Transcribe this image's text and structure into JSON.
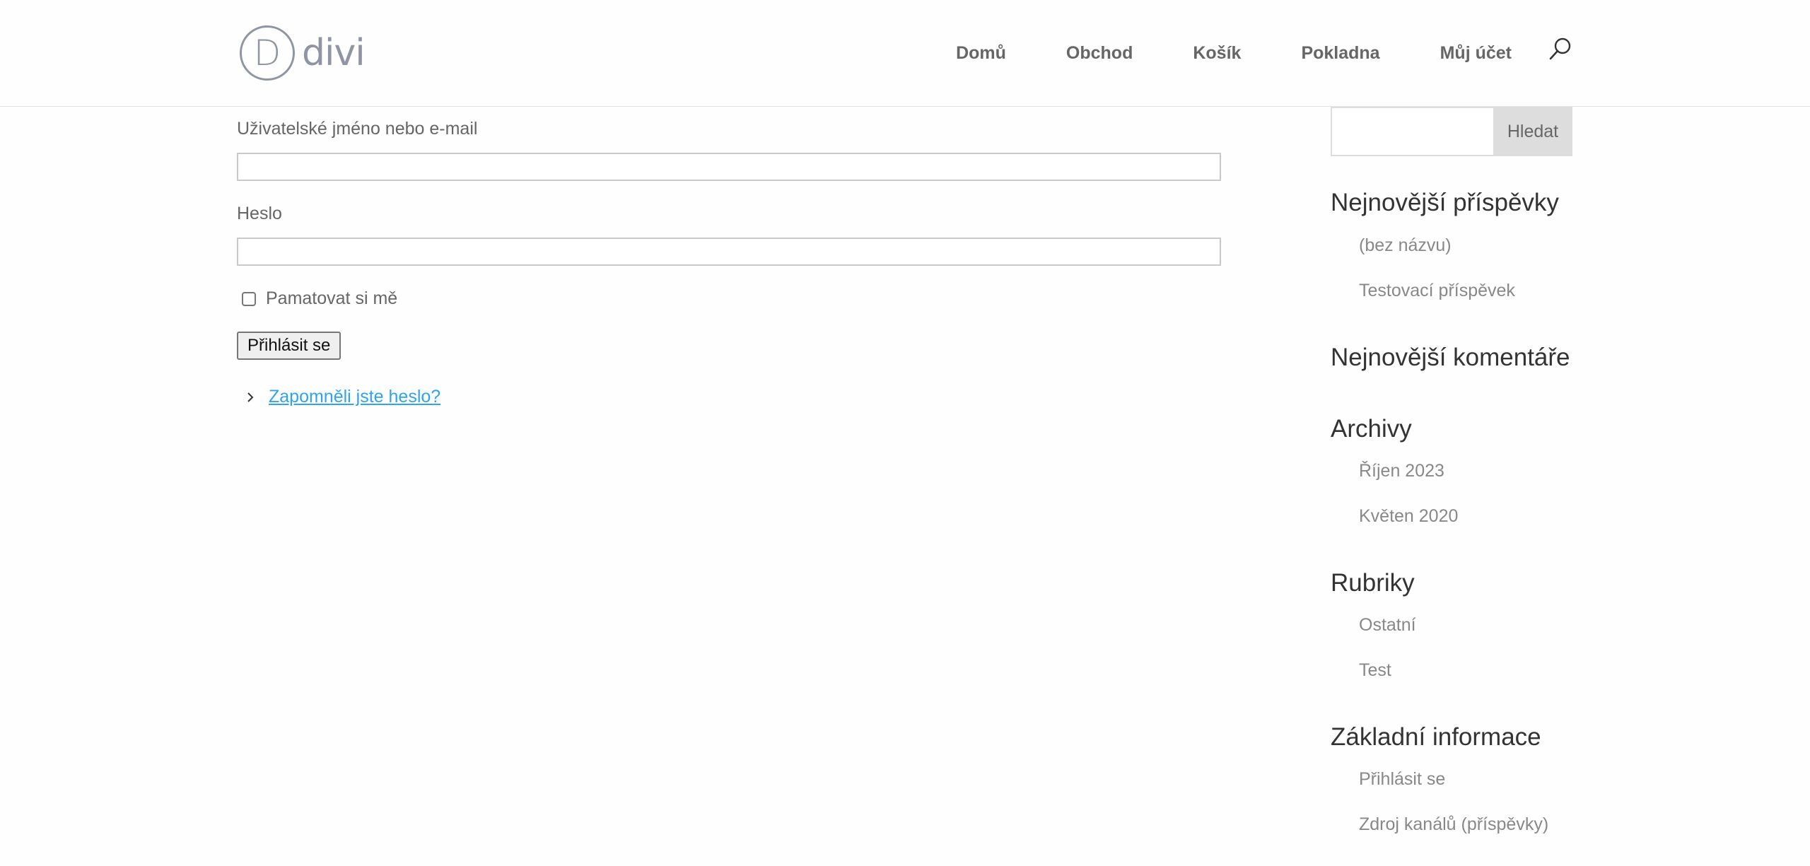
{
  "header": {
    "logo_text": "divi",
    "logo_mark": "D",
    "nav": [
      "Domů",
      "Obchod",
      "Košík",
      "Pokladna",
      "Můj účet"
    ]
  },
  "login": {
    "username_label": "Uživatelské jméno nebo e-mail",
    "username_value": "",
    "password_label": "Heslo",
    "password_value": "",
    "remember_label": "Pamatovat si mě",
    "remember_checked": false,
    "submit_label": "Přihlásit se",
    "lost_password": "Zapomněli jste heslo?"
  },
  "sidebar": {
    "search": {
      "value": "",
      "button": "Hledat"
    },
    "recent_posts": {
      "title": "Nejnovější příspěvky",
      "items": [
        "(bez názvu)",
        "Testovací příspěvek"
      ]
    },
    "recent_comments": {
      "title": "Nejnovější komentáře"
    },
    "archives": {
      "title": "Archivy",
      "items": [
        "Říjen 2023",
        "Květen 2020"
      ]
    },
    "categories": {
      "title": "Rubriky",
      "items": [
        "Ostatní",
        "Test"
      ]
    },
    "meta": {
      "title": "Základní informace",
      "items": [
        "Přihlásit se",
        "Zdroj kanálů (příspěvky)"
      ]
    }
  },
  "colors": {
    "link": "#2ea3f2",
    "text": "#666666",
    "heading": "#333333",
    "muted": "#888888"
  }
}
